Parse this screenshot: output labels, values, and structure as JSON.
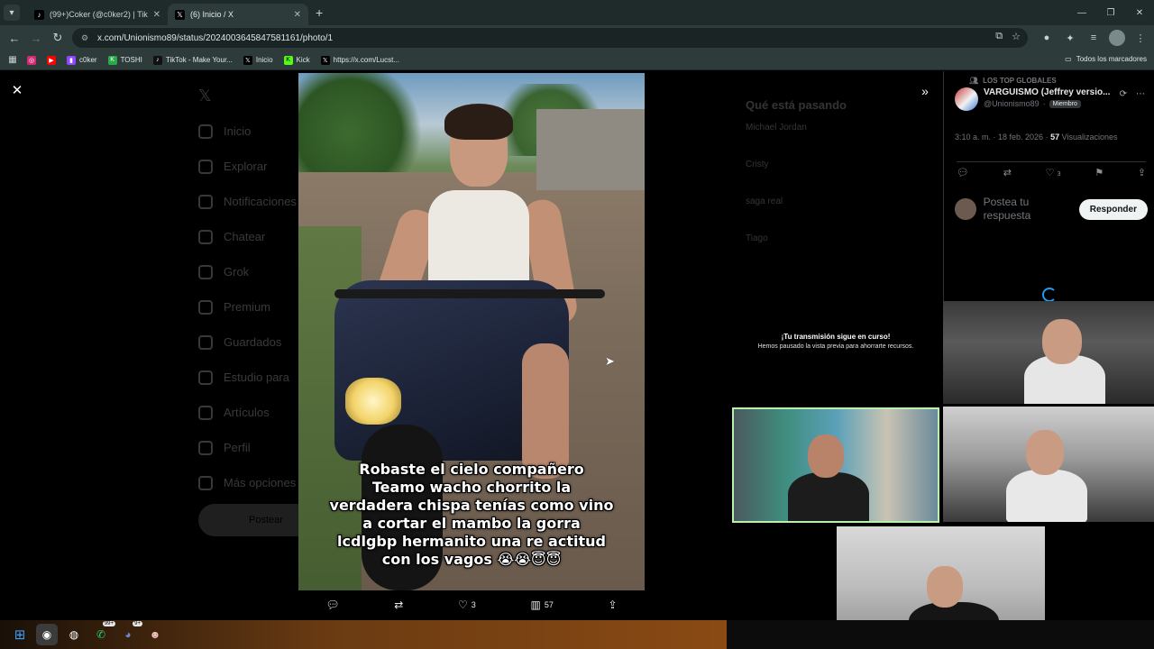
{
  "browser": {
    "tabs": [
      {
        "title": "(99+)Coker (@c0ker2) | TikTok",
        "icon": "tiktok-icon",
        "active": false
      },
      {
        "title": "(6) Inicio / X",
        "icon": "x-icon",
        "active": true
      }
    ],
    "url": "x.com/Unionismo89/status/2024003645847581161/photo/1",
    "bookmarks": [
      {
        "label": "",
        "icon": "instagram-icon",
        "color": "#d62976"
      },
      {
        "label": "",
        "icon": "youtube-icon",
        "color": "#ff0000"
      },
      {
        "label": "c0ker",
        "icon": "twitch-icon",
        "color": "#9146ff"
      },
      {
        "label": "TOSHI",
        "icon": "kick-icon",
        "color": "#53fc18"
      },
      {
        "label": "TikTok - Make Your...",
        "icon": "tiktok-icon",
        "color": "#111111"
      },
      {
        "label": "Inicio",
        "icon": "x-icon",
        "color": "#000000"
      },
      {
        "label": "Kick",
        "icon": "kick-icon",
        "color": "#53fc18"
      },
      {
        "label": "https://x.com/Lucst...",
        "icon": "x-icon",
        "color": "#000000"
      }
    ],
    "all_bookmarks_label": "Todos los marcadores"
  },
  "sidebar_dim": [
    "Inicio",
    "Explorar",
    "Notificaciones",
    "Chatear",
    "Grok",
    "Premium",
    "Guardados",
    "Estudio para",
    "Artículos",
    "Perfil",
    "Más opciones"
  ],
  "sidebar_post_label": "Postear",
  "trends_dim": {
    "title": "Qué está pasando",
    "rows": [
      "Michael Jordan",
      "Cristy",
      "saga real",
      "Tiago"
    ]
  },
  "photo": {
    "caption_lines": [
      "Robaste el cielo compañero",
      "Teamo wacho chorrito la",
      "verdadera chispa tenías como vino",
      "a cortar el mambo la gorra",
      "lcdlgbp hermanito una re actitud",
      "con los vagos 😭😭😇😇"
    ]
  },
  "photo_actions": {
    "likes": "3",
    "views": "57"
  },
  "tweet": {
    "top_label": "LOS TOP GLOBALES",
    "name": "VARGUISMO (Jeffrey versio...",
    "handle": "@Unionismo89",
    "badge": "Miembro",
    "time": "3:10 a. m. · 18 feb. 2026 ·",
    "views_count": "57",
    "views_label": "Visualizaciones",
    "likes": "3",
    "reply_placeholder": "Postea tu respuesta",
    "reply_button": "Responder"
  },
  "stream": {
    "message_title": "¡Tu transmisión sigue en curso!",
    "message_body": "Hemos pausado la vista previa para ahorrarte recursos."
  },
  "taskbar": {
    "whatsapp_badge": "99+",
    "discord_badge": "9+"
  }
}
